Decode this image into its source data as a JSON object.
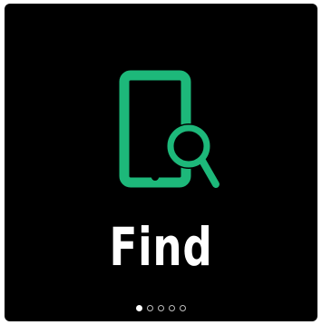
{
  "screen": {
    "title": "Find",
    "icon": "phone-search-icon",
    "accent_color": "#1db87a",
    "pager": {
      "total": 5,
      "active_index": 0
    }
  }
}
